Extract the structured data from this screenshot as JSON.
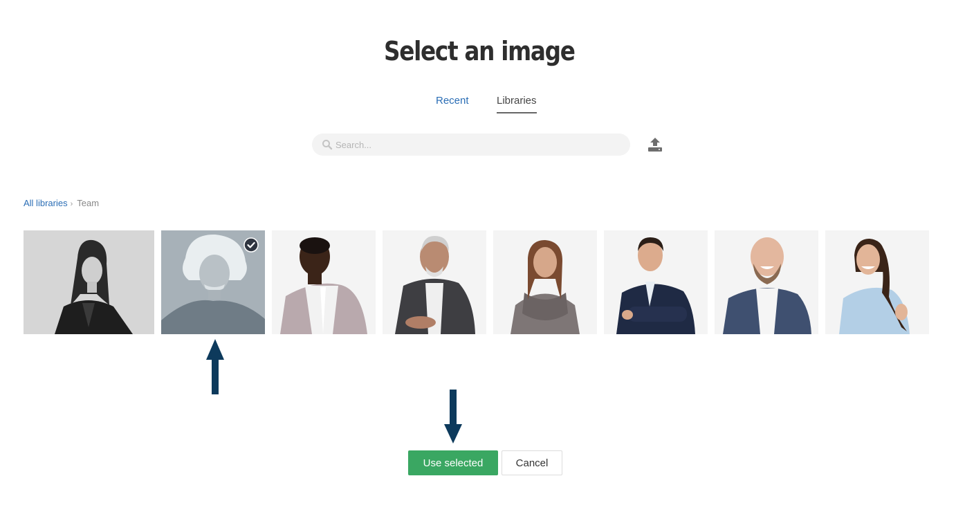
{
  "dialog": {
    "title": "Select an image"
  },
  "tabs": [
    {
      "label": "Recent",
      "active": false
    },
    {
      "label": "Libraries",
      "active": true
    }
  ],
  "search": {
    "placeholder": "Search...",
    "value": ""
  },
  "toolbar": {
    "upload_icon": "upload-icon"
  },
  "breadcrumb": {
    "items": [
      "All libraries",
      "Team"
    ],
    "separator": "›"
  },
  "images": [
    {
      "description": "woman in black blazer, grayscale",
      "selected": false
    },
    {
      "description": "elderly man with white hair, grayscale",
      "selected": true
    },
    {
      "description": "young man in checked blazer",
      "selected": false
    },
    {
      "description": "older man with glasses seated",
      "selected": false
    },
    {
      "description": "woman in gray knit poncho",
      "selected": false
    },
    {
      "description": "man in navy suit, arms crossed",
      "selected": false
    },
    {
      "description": "bald bearded man laughing",
      "selected": false
    },
    {
      "description": "woman in light blue shirt, thumbs up",
      "selected": false
    }
  ],
  "actions": {
    "use_selected": "Use selected",
    "cancel": "Cancel"
  },
  "colors": {
    "accent_link": "#2a6db5",
    "primary_button": "#3aa762",
    "annotation_arrow": "#0d3a5c"
  }
}
